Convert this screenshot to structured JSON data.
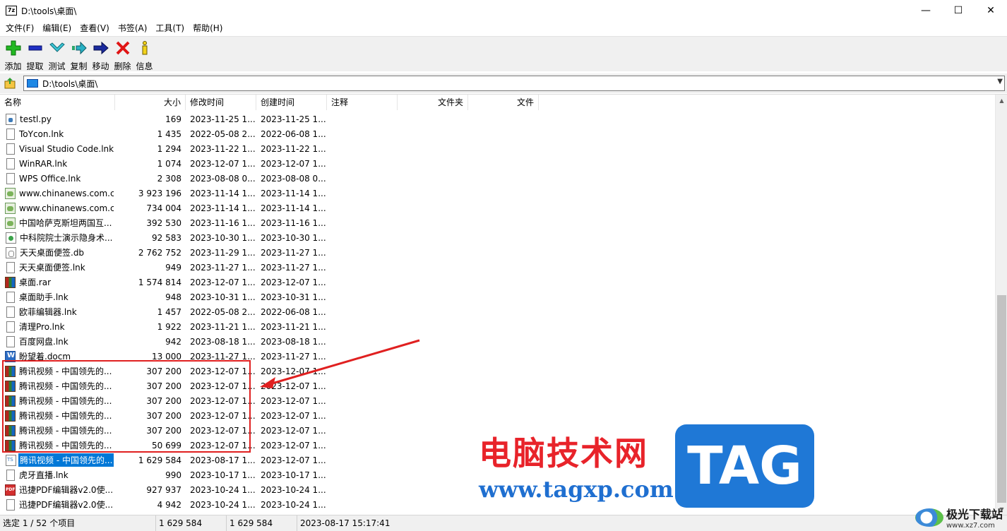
{
  "window": {
    "title": "D:\\tools\\桌面\\",
    "app_icon": "7z",
    "controls": {
      "minimize": "—",
      "maximize": "☐",
      "close": "✕"
    }
  },
  "menu": [
    "文件(F)",
    "编辑(E)",
    "查看(V)",
    "书签(A)",
    "工具(T)",
    "帮助(H)"
  ],
  "toolbar": [
    {
      "label": "添加",
      "icon": "add-icon"
    },
    {
      "label": "提取",
      "icon": "extract-icon"
    },
    {
      "label": "测试",
      "icon": "test-icon"
    },
    {
      "label": "复制",
      "icon": "copy-icon"
    },
    {
      "label": "移动",
      "icon": "move-icon"
    },
    {
      "label": "删除",
      "icon": "delete-icon"
    },
    {
      "label": "信息",
      "icon": "info-icon"
    }
  ],
  "address": {
    "path": "D:\\tools\\桌面\\"
  },
  "columns": [
    "名称",
    "大小",
    "修改时间",
    "创建时间",
    "注释",
    "文件夹",
    "文件"
  ],
  "files": [
    {
      "name": "testl.py",
      "size": "169",
      "modified": "2023-11-25 1...",
      "created": "2023-11-25 1...",
      "icon": "py"
    },
    {
      "name": "ToYcon.lnk",
      "size": "1 435",
      "modified": "2022-05-08 2...",
      "created": "2022-06-08 1...",
      "icon": "doc"
    },
    {
      "name": "Visual Studio Code.lnk",
      "size": "1 294",
      "modified": "2023-11-22 1...",
      "created": "2023-11-22 1...",
      "icon": "doc"
    },
    {
      "name": "WinRAR.lnk",
      "size": "1 074",
      "modified": "2023-12-07 1...",
      "created": "2023-12-07 1...",
      "icon": "doc"
    },
    {
      "name": "WPS Office.lnk",
      "size": "2 308",
      "modified": "2023-08-08 0...",
      "created": "2023-08-08 0...",
      "icon": "doc"
    },
    {
      "name": "www.chinanews.com.c...",
      "size": "3 923 196",
      "modified": "2023-11-14 1...",
      "created": "2023-11-14 1...",
      "icon": "mht"
    },
    {
      "name": "www.chinanews.com.c...",
      "size": "734 004",
      "modified": "2023-11-14 1...",
      "created": "2023-11-14 1...",
      "icon": "mht"
    },
    {
      "name": "中国哈萨克斯坦两国互...",
      "size": "392 530",
      "modified": "2023-11-16 1...",
      "created": "2023-11-16 1...",
      "icon": "mht"
    },
    {
      "name": "中科院院士演示隐身术...",
      "size": "92 583",
      "modified": "2023-10-30 1...",
      "created": "2023-10-30 1...",
      "icon": "edge"
    },
    {
      "name": "天天桌面便签.db",
      "size": "2 762 752",
      "modified": "2023-11-29 1...",
      "created": "2023-11-27 1...",
      "icon": "db"
    },
    {
      "name": "天天桌面便签.lnk",
      "size": "949",
      "modified": "2023-11-27 1...",
      "created": "2023-11-27 1...",
      "icon": "doc"
    },
    {
      "name": "桌面.rar",
      "size": "1 574 814",
      "modified": "2023-12-07 1...",
      "created": "2023-12-07 1...",
      "icon": "rar"
    },
    {
      "name": "桌面助手.lnk",
      "size": "948",
      "modified": "2023-10-31 1...",
      "created": "2023-10-31 1...",
      "icon": "doc"
    },
    {
      "name": "欧菲编辑器.lnk",
      "size": "1 457",
      "modified": "2022-05-08 2...",
      "created": "2022-06-08 1...",
      "icon": "doc"
    },
    {
      "name": "清理Pro.lnk",
      "size": "1 922",
      "modified": "2023-11-21 1...",
      "created": "2023-11-21 1...",
      "icon": "doc"
    },
    {
      "name": "百度网盘.lnk",
      "size": "942",
      "modified": "2023-08-18 1...",
      "created": "2023-08-18 1...",
      "icon": "doc"
    },
    {
      "name": "盼望着.docm",
      "size": "13 000",
      "modified": "2023-11-27 1...",
      "created": "2023-11-27 1...",
      "icon": "word"
    },
    {
      "name": "腾讯视频 - 中国领先的...",
      "size": "307 200",
      "modified": "2023-12-07 1...",
      "created": "2023-12-07 1...",
      "icon": "rar"
    },
    {
      "name": "腾讯视频 - 中国领先的...",
      "size": "307 200",
      "modified": "2023-12-07 1...",
      "created": "2023-12-07 1...",
      "icon": "rar"
    },
    {
      "name": "腾讯视频 - 中国领先的...",
      "size": "307 200",
      "modified": "2023-12-07 1...",
      "created": "2023-12-07 1...",
      "icon": "rar"
    },
    {
      "name": "腾讯视频 - 中国领先的...",
      "size": "307 200",
      "modified": "2023-12-07 1...",
      "created": "2023-12-07 1...",
      "icon": "rar"
    },
    {
      "name": "腾讯视频 - 中国领先的...",
      "size": "307 200",
      "modified": "2023-12-07 1...",
      "created": "2023-12-07 1...",
      "icon": "rar"
    },
    {
      "name": "腾讯视频 - 中国领先的...",
      "size": "50 699",
      "modified": "2023-12-07 1...",
      "created": "2023-12-07 1...",
      "icon": "rar"
    },
    {
      "name": "腾讯视频 - 中国领先的...",
      "size": "1 629 584",
      "modified": "2023-08-17 1...",
      "created": "2023-12-07 1...",
      "icon": "ts",
      "selected": true
    },
    {
      "name": "虎牙直播.lnk",
      "size": "990",
      "modified": "2023-10-17 1...",
      "created": "2023-10-17 1...",
      "icon": "doc"
    },
    {
      "name": "迅捷PDF编辑器v2.0使...",
      "size": "927 937",
      "modified": "2023-10-24 1...",
      "created": "2023-10-24 1...",
      "icon": "pdf"
    },
    {
      "name": "迅捷PDF编辑器v2.0使...",
      "size": "4 942",
      "modified": "2023-10-24 1...",
      "created": "2023-10-24 1...",
      "icon": "doc"
    }
  ],
  "status": {
    "selection": "选定 1 / 52 个项目",
    "size": "1 629 584",
    "packed": "1 629 584",
    "datetime": "2023-08-17 15:17:41"
  },
  "watermark": {
    "cn": "电脑技术网",
    "url": "www.tagxp.com",
    "tag": "TAG",
    "corner_title": "极光下载站",
    "corner_url": "www.xz7.com"
  },
  "colors": {
    "annotation": "#e02020",
    "selection": "#0078d7",
    "watermark_red": "#e8232a",
    "watermark_blue": "#1f78d6"
  }
}
